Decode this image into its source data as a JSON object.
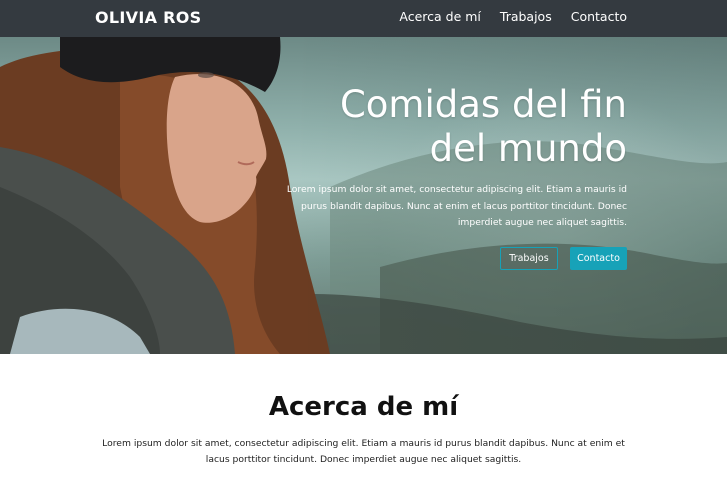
{
  "navbar": {
    "brand": "OLIVIA ROS",
    "links": [
      "Acerca de mí",
      "Trabajos",
      "Contacto"
    ]
  },
  "hero": {
    "title_line1": "Comidas del fin",
    "title_line2": "del mundo",
    "text": "Lorem ipsum dolor sit amet, consectetur adipiscing elit. Etiam a mauris id purus blandit dapibus. Nunc at enim et lacus porttitor tincidunt. Donec imperdiet augue nec aliquet sagittis.",
    "buttons": {
      "primary": "Trabajos",
      "secondary": "Contacto"
    }
  },
  "about": {
    "title": "Acerca de mí",
    "text": "Lorem ipsum dolor sit amet, consectetur adipiscing elit. Etiam a mauris id purus blandit dapibus. Nunc at enim et lacus porttitor tincidunt. Donec imperdiet augue nec aliquet sagittis."
  },
  "colors": {
    "navbar_bg": "#343a40",
    "accent": "#17a2b8",
    "text_dark": "#111111"
  }
}
